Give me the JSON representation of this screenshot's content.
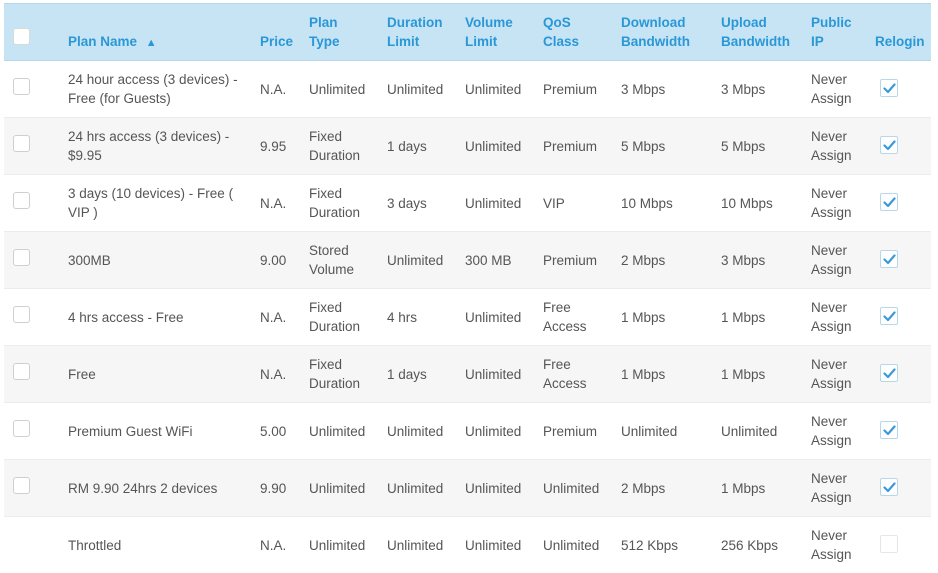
{
  "header": {
    "plan_name": "Plan Name",
    "sort_indicator": "▲",
    "price": "Price",
    "plan_type": [
      "Plan",
      "Type"
    ],
    "duration_limit": [
      "Duration",
      "Limit"
    ],
    "volume_limit": [
      "Volume",
      "Limit"
    ],
    "qos_class": [
      "QoS",
      "Class"
    ],
    "download_bandwidth": [
      "Download",
      "Bandwidth"
    ],
    "upload_bandwidth": [
      "Upload",
      "Bandwidth"
    ],
    "public_ip": [
      "Public",
      "IP"
    ],
    "relogin": "Relogin"
  },
  "colors": {
    "header_bg": "#c7e4f5",
    "header_text": "#2a97d6",
    "check_accent": "#3a9ad9",
    "row_alt": "#f6f6f6"
  },
  "rows": [
    {
      "name": [
        "24 hour access (3 devices) -",
        "Free (for Guests)"
      ],
      "price": "N.A.",
      "plan_type": [
        "Unlimited"
      ],
      "duration": "Unlimited",
      "volume": "Unlimited",
      "qos": [
        "Premium"
      ],
      "download": "3 Mbps",
      "upload": "3 Mbps",
      "public_ip": [
        "Never",
        "Assign"
      ],
      "relogin": true,
      "selectable": true
    },
    {
      "name": [
        "24 hrs access (3 devices) -",
        "$9.95"
      ],
      "price": "9.95",
      "plan_type": [
        "Fixed",
        "Duration"
      ],
      "duration": "1 days",
      "volume": "Unlimited",
      "qos": [
        "Premium"
      ],
      "download": "5 Mbps",
      "upload": "5 Mbps",
      "public_ip": [
        "Never",
        "Assign"
      ],
      "relogin": true,
      "selectable": true
    },
    {
      "name": [
        "3 days (10 devices) - Free (",
        "VIP )"
      ],
      "price": "N.A.",
      "plan_type": [
        "Fixed",
        "Duration"
      ],
      "duration": "3 days",
      "volume": "Unlimited",
      "qos": [
        "VIP"
      ],
      "download": "10 Mbps",
      "upload": "10 Mbps",
      "public_ip": [
        "Never",
        "Assign"
      ],
      "relogin": true,
      "selectable": true
    },
    {
      "name": [
        "300MB"
      ],
      "price": "9.00",
      "plan_type": [
        "Stored",
        "Volume"
      ],
      "duration": "Unlimited",
      "volume": "300 MB",
      "qos": [
        "Premium"
      ],
      "download": "2 Mbps",
      "upload": "3 Mbps",
      "public_ip": [
        "Never",
        "Assign"
      ],
      "relogin": true,
      "selectable": true
    },
    {
      "name": [
        "4 hrs access - Free"
      ],
      "price": "N.A.",
      "plan_type": [
        "Fixed",
        "Duration"
      ],
      "duration": "4 hrs",
      "volume": "Unlimited",
      "qos": [
        "Free",
        "Access"
      ],
      "download": "1 Mbps",
      "upload": "1 Mbps",
      "public_ip": [
        "Never",
        "Assign"
      ],
      "relogin": true,
      "selectable": true
    },
    {
      "name": [
        "Free"
      ],
      "price": "N.A.",
      "plan_type": [
        "Fixed",
        "Duration"
      ],
      "duration": "1 days",
      "volume": "Unlimited",
      "qos": [
        "Free",
        "Access"
      ],
      "download": "1 Mbps",
      "upload": "1 Mbps",
      "public_ip": [
        "Never",
        "Assign"
      ],
      "relogin": true,
      "selectable": true
    },
    {
      "name": [
        "Premium Guest WiFi"
      ],
      "price": "5.00",
      "plan_type": [
        "Unlimited"
      ],
      "duration": "Unlimited",
      "volume": "Unlimited",
      "qos": [
        "Premium"
      ],
      "download": "Unlimited",
      "upload": "Unlimited",
      "public_ip": [
        "Never",
        "Assign"
      ],
      "relogin": true,
      "selectable": true
    },
    {
      "name": [
        "RM 9.90 24hrs 2 devices"
      ],
      "price": "9.90",
      "plan_type": [
        "Unlimited"
      ],
      "duration": "Unlimited",
      "volume": "Unlimited",
      "qos": [
        "Unlimited"
      ],
      "download": "2 Mbps",
      "upload": "1 Mbps",
      "public_ip": [
        "Never",
        "Assign"
      ],
      "relogin": true,
      "selectable": true
    },
    {
      "name": [
        "Throttled"
      ],
      "price": "N.A.",
      "plan_type": [
        "Unlimited"
      ],
      "duration": "Unlimited",
      "volume": "Unlimited",
      "qos": [
        "Unlimited"
      ],
      "download": "512 Kbps",
      "upload": "256 Kbps",
      "public_ip": [
        "Never",
        "Assign"
      ],
      "relogin": false,
      "selectable": false
    }
  ]
}
